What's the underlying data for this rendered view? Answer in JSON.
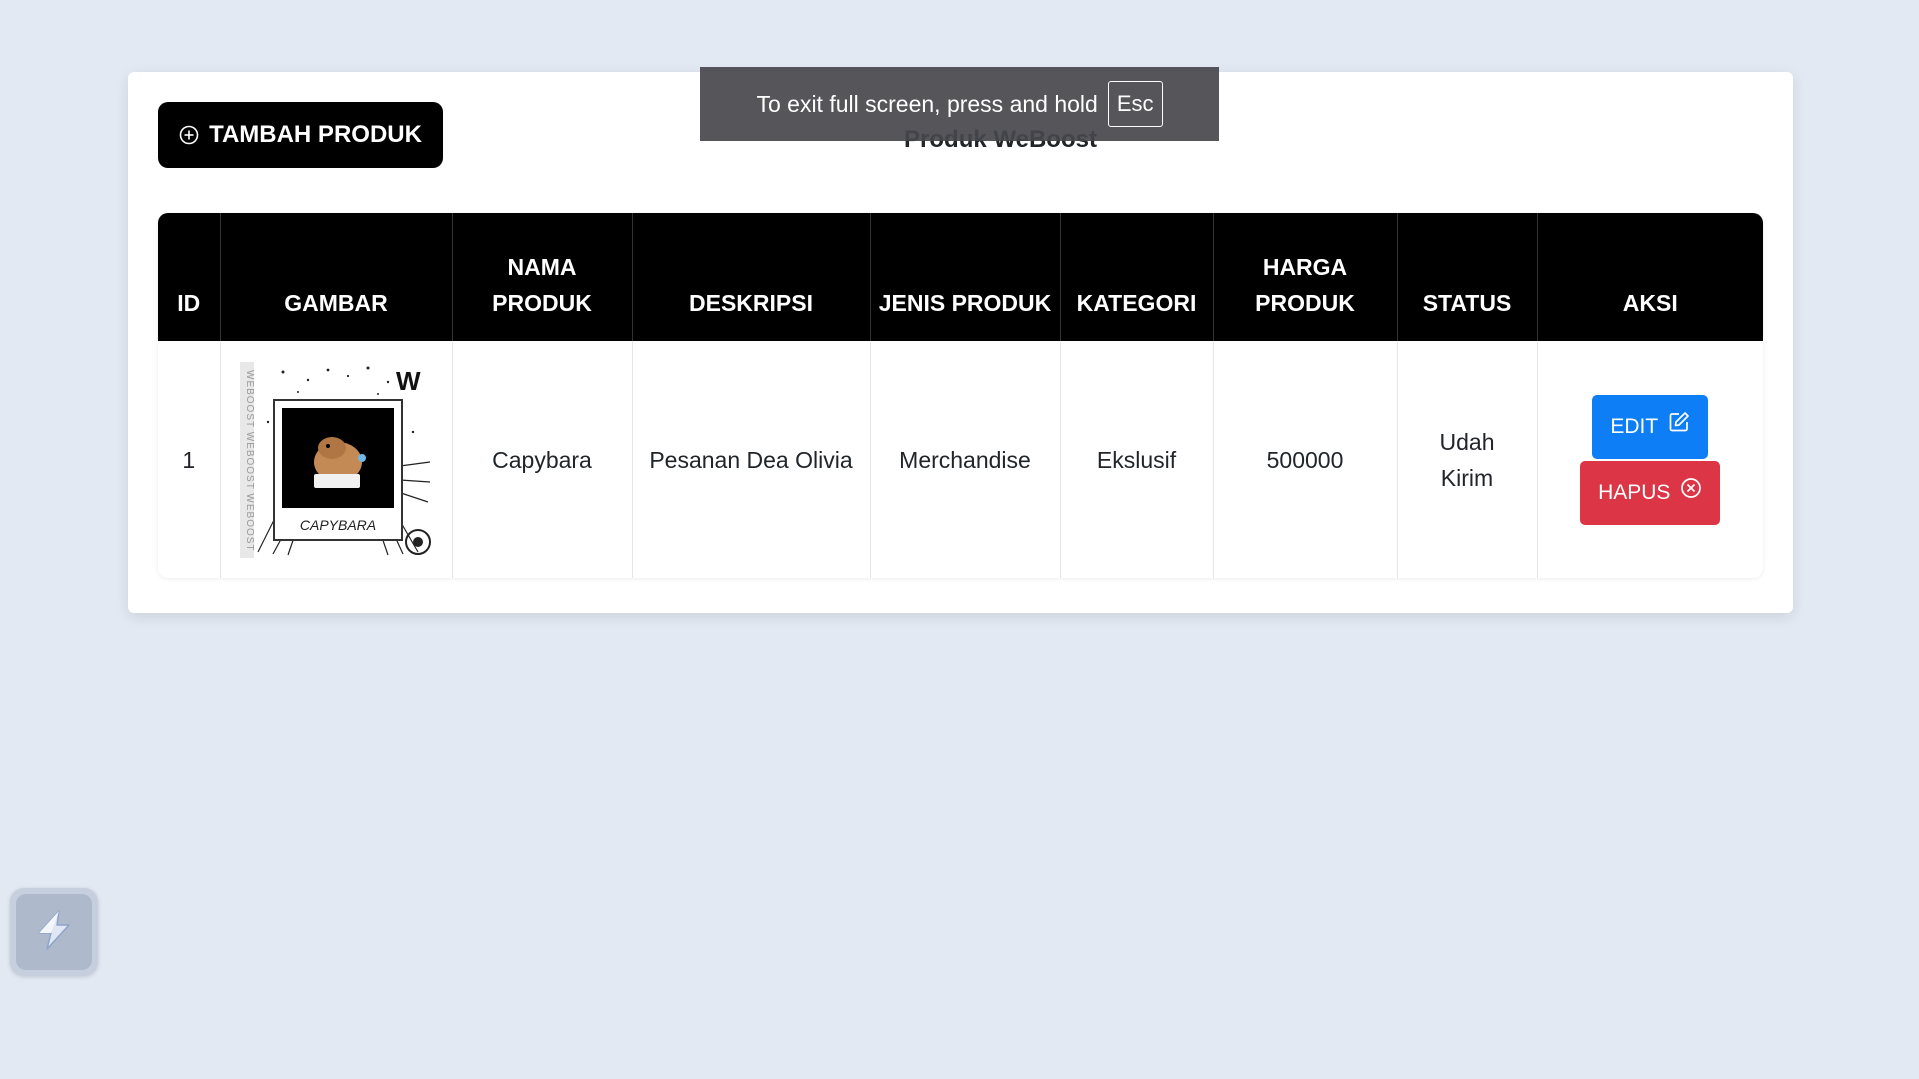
{
  "toolbar": {
    "add_label": "TAMBAH PRODUK",
    "title": "Produk WeBoost"
  },
  "fullscreen_notice": {
    "text": "To exit full screen, press and hold",
    "key": "Esc"
  },
  "table": {
    "headers": {
      "id": "ID",
      "image": "GAMBAR",
      "name": "NAMA PRODUK",
      "description": "DESKRIPSI",
      "type": "JENIS PRODUK",
      "category": "KATEGORI",
      "price": "HARGA PRODUK",
      "status": "STATUS",
      "actions": "AKSI"
    },
    "rows": [
      {
        "id": "1",
        "image_caption": "CAPYBARA",
        "name": "Capybara",
        "description": "Pesanan Dea Olivia",
        "type": "Merchandise",
        "category": "Ekslusif",
        "price": "500000",
        "status": "Udah Kirim",
        "edit_label": "EDIT",
        "delete_label": "HAPUS"
      }
    ]
  },
  "colors": {
    "page_bg": "#e3e9f3",
    "header_bg": "#000000",
    "edit_button": "#0d7ef5",
    "delete_button": "#dc3545"
  },
  "icons": {
    "add": "plus-circle-icon",
    "edit": "edit-square-icon",
    "delete": "x-circle-icon",
    "widget": "lightning-app-icon"
  }
}
